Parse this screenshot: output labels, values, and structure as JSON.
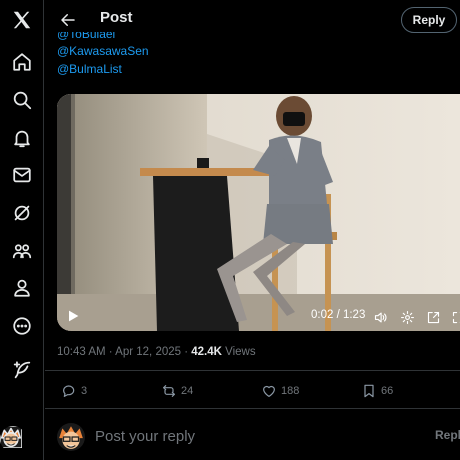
{
  "header": {
    "title": "Post",
    "reply_button": "Reply"
  },
  "tweet": {
    "mentions": [
      "@ToBulaei",
      "@KawasawaSen",
      "@BulmaList"
    ],
    "video": {
      "time": "0:02 / 1:23",
      "progress_fraction": 0.025
    },
    "timestamp": "10:43 AM · Apr 12, 2025 · ",
    "views_count": "42.4K",
    "views_label": " Views",
    "stats": {
      "replies": "3",
      "reposts": "24",
      "likes": "188",
      "bookmarks": "66"
    }
  },
  "compose": {
    "placeholder": "Post your reply",
    "reply_button": "Reply"
  },
  "nav_icons": [
    "x-logo-icon",
    "home-icon",
    "search-icon",
    "notifications-icon",
    "messages-icon",
    "grok-icon",
    "communities-icon",
    "profile-icon",
    "more-icon",
    "post-icon"
  ],
  "colors": {
    "background": "#000000",
    "link": "#1d9bf0",
    "muted": "#71767b",
    "border": "#2f3336",
    "text": "#e7e9ea"
  }
}
